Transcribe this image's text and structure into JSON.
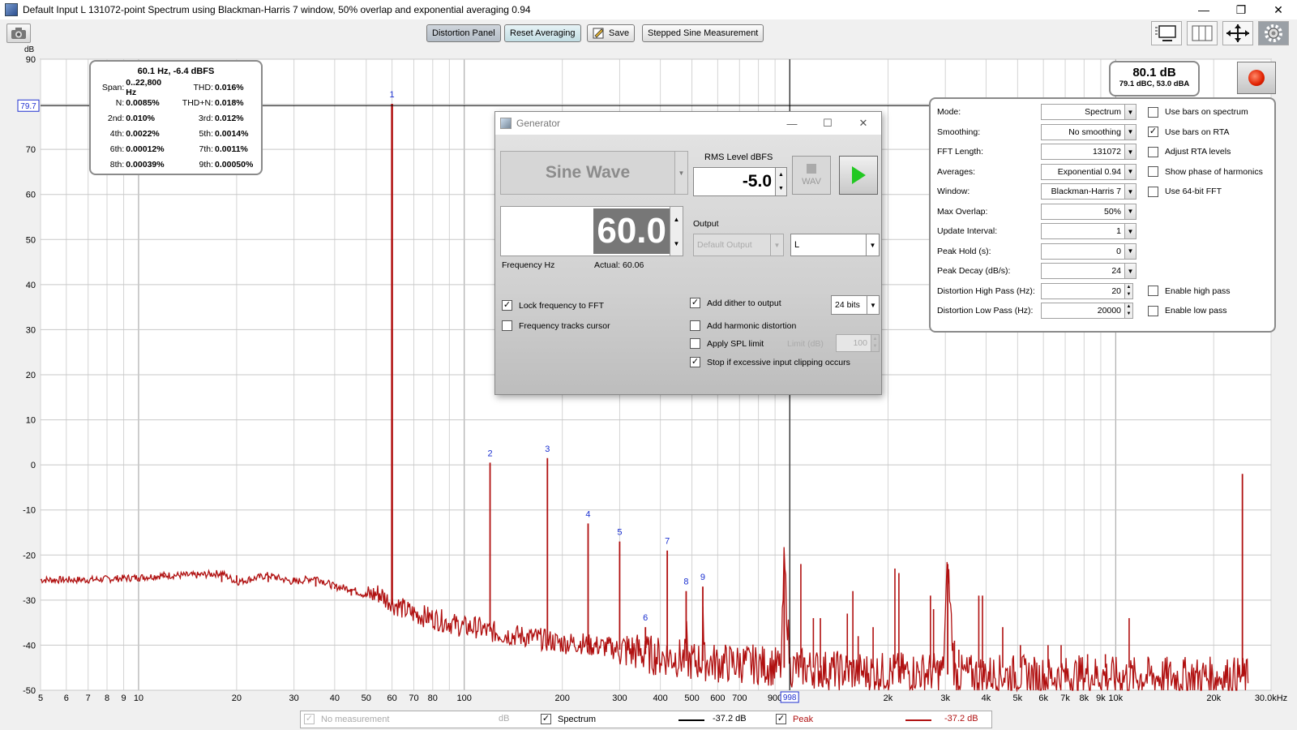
{
  "window": {
    "title": "Default Input L 131072-point Spectrum using Blackman-Harris 7 window, 50% overlap and exponential averaging 0.94",
    "minimize_glyph": "—",
    "restore_glyph": "❐",
    "close_glyph": "✕"
  },
  "toolbar": {
    "distortion_panel": "Distortion Panel",
    "reset_averaging": "Reset Averaging",
    "save": "Save",
    "stepped_sine": "Stepped Sine Measurement"
  },
  "graph": {
    "y_unit": "dB",
    "y_ticks": [
      "90",
      "80",
      "70",
      "60",
      "50",
      "40",
      "30",
      "20",
      "10",
      "0",
      "-10",
      "-20",
      "-30",
      "-40",
      "-50"
    ],
    "x_ticks": [
      {
        "v": 5,
        "l": "5"
      },
      {
        "v": 6,
        "l": "6"
      },
      {
        "v": 7,
        "l": "7"
      },
      {
        "v": 8,
        "l": "8"
      },
      {
        "v": 9,
        "l": "9"
      },
      {
        "v": 10,
        "l": "10"
      },
      {
        "v": 20,
        "l": "20"
      },
      {
        "v": 30,
        "l": "30"
      },
      {
        "v": 40,
        "l": "40"
      },
      {
        "v": 50,
        "l": "50"
      },
      {
        "v": 60,
        "l": "60"
      },
      {
        "v": 70,
        "l": "70"
      },
      {
        "v": 80,
        "l": "80"
      },
      {
        "v": 100,
        "l": "100"
      },
      {
        "v": 200,
        "l": "200"
      },
      {
        "v": 300,
        "l": "300"
      },
      {
        "v": 400,
        "l": "400"
      },
      {
        "v": 500,
        "l": "500"
      },
      {
        "v": 600,
        "l": "600"
      },
      {
        "v": 700,
        "l": "700"
      },
      {
        "v": 900,
        "l": "900"
      },
      {
        "v": 2000,
        "l": "2k"
      },
      {
        "v": 3000,
        "l": "3k"
      },
      {
        "v": 4000,
        "l": "4k"
      },
      {
        "v": 5000,
        "l": "5k"
      },
      {
        "v": 6000,
        "l": "6k"
      },
      {
        "v": 7000,
        "l": "7k"
      },
      {
        "v": 8000,
        "l": "8k"
      },
      {
        "v": 9000,
        "l": "9k"
      },
      {
        "v": 10000,
        "l": "10k"
      },
      {
        "v": 20000,
        "l": "20k"
      },
      {
        "v": 30000,
        "l": "30.0kHz"
      }
    ],
    "cursor_y_label": "79.7",
    "cursor_y": 79.7,
    "cursor_x_label": "998",
    "cursor_x": 998,
    "harmonic_markers": [
      {
        "label": "1",
        "freq": 60,
        "db": 80.1
      },
      {
        "label": "2",
        "freq": 120,
        "db": 0.5
      },
      {
        "label": "3",
        "freq": 180,
        "db": 1.5
      },
      {
        "label": "4",
        "freq": 240,
        "db": -13
      },
      {
        "label": "5",
        "freq": 300,
        "db": -17
      },
      {
        "label": "6",
        "freq": 360,
        "db": -36
      },
      {
        "label": "7",
        "freq": 420,
        "db": -19
      },
      {
        "label": "8",
        "freq": 480,
        "db": -28
      },
      {
        "label": "9",
        "freq": 540,
        "db": -27
      }
    ]
  },
  "chart_data": {
    "type": "line",
    "xlabel": "",
    "ylabel": "dB",
    "x_scale": "log",
    "xlim": [
      5,
      30000
    ],
    "ylim": [
      -50,
      90
    ],
    "series": [
      {
        "name": "Spectrum",
        "color": "#000000",
        "x": [],
        "values": []
      },
      {
        "name": "Peak",
        "color": "#b01010",
        "x": [
          5,
          7,
          10,
          12,
          15,
          18,
          20,
          25,
          30,
          35,
          40,
          45,
          50,
          55,
          58,
          60,
          62,
          65,
          70,
          80,
          90,
          100,
          110,
          118,
          120,
          122,
          130,
          150,
          170,
          178,
          180,
          182,
          200,
          230,
          238,
          240,
          242,
          280,
          298,
          300,
          302,
          340,
          358,
          360,
          362,
          400,
          418,
          420,
          422,
          470,
          478,
          480,
          482,
          530,
          538,
          540,
          542,
          600,
          700,
          850,
          940,
          960,
          1000,
          1100,
          1300,
          1700,
          2000,
          2500,
          2950,
          3050,
          3200,
          4000,
          5000,
          6000,
          7000,
          8000,
          10000,
          14000,
          18000,
          20000,
          23000,
          24000,
          24500,
          25000,
          26000
        ],
        "values": [
          -25.5,
          -25.5,
          -25,
          -24.5,
          -24.5,
          -24,
          -26,
          -24.5,
          -26,
          -25,
          -27,
          -27.5,
          -29,
          -28.5,
          -30,
          80.1,
          -31,
          -32,
          -33,
          -34,
          -35,
          -36,
          -36,
          -37,
          0.5,
          -37,
          -37.5,
          -38,
          -38.5,
          -39,
          1.5,
          -39,
          -39.5,
          -39.5,
          -40,
          -13,
          -40,
          -40.5,
          -41,
          -17,
          -41,
          -41.5,
          -42,
          -36,
          -42,
          -42.5,
          -42.5,
          -19,
          -42.5,
          -43,
          -43,
          -28,
          -43.5,
          -43.5,
          -43.5,
          -27,
          -43.5,
          -44,
          -44,
          -44.5,
          -45,
          -21,
          -45,
          -45,
          -45.5,
          -46,
          -46,
          -46,
          -46,
          -22,
          -46.5,
          -46.5,
          -46.5,
          -47,
          -47,
          -46.5,
          -47,
          -47,
          -47,
          -47,
          -47,
          -47,
          -2,
          -47,
          -48
        ]
      }
    ],
    "legend": "bottom"
  },
  "infobox": {
    "header": "60.1 Hz, -6.4 dBFS",
    "rows": [
      {
        "l1": "Span:",
        "v1": "0..22,800 Hz",
        "l2": "THD:",
        "v2": "0.016%"
      },
      {
        "l1": "N:",
        "v1": "0.0085%",
        "l2": "THD+N:",
        "v2": "0.018%"
      },
      {
        "l1": "2nd:",
        "v1": "0.010%",
        "l2": "3rd:",
        "v2": "0.012%"
      },
      {
        "l1": "4th:",
        "v1": "0.0022%",
        "l2": "5th:",
        "v2": "0.0014%"
      },
      {
        "l1": "6th:",
        "v1": "0.00012%",
        "l2": "7th:",
        "v2": "0.0011%"
      },
      {
        "l1": "8th:",
        "v1": "0.00039%",
        "l2": "9th:",
        "v2": "0.00050%"
      }
    ]
  },
  "spl": {
    "main": "80.1 dB",
    "sub": "79.1 dBC, 53.0 dBA"
  },
  "settings": {
    "rows": [
      {
        "label": "Mode:",
        "value": "Spectrum",
        "kind": "select"
      },
      {
        "label": "Smoothing:",
        "value": "No  smoothing",
        "kind": "select"
      },
      {
        "label": "FFT Length:",
        "value": "131072",
        "kind": "select"
      },
      {
        "label": "Averages:",
        "value": "Exponential 0.94",
        "kind": "select"
      },
      {
        "label": "Window:",
        "value": "Blackman-Harris 7",
        "kind": "select"
      },
      {
        "label": "Max Overlap:",
        "value": "50%",
        "kind": "select"
      },
      {
        "label": "Update Interval:",
        "value": "1",
        "kind": "select"
      },
      {
        "label": "Peak Hold (s):",
        "value": "0",
        "kind": "select"
      },
      {
        "label": "Peak Decay (dB/s):",
        "value": "24",
        "kind": "select"
      },
      {
        "label": "Distortion High Pass (Hz):",
        "value": "20",
        "kind": "spin"
      },
      {
        "label": "Distortion Low Pass (Hz):",
        "value": "20000",
        "kind": "spin"
      }
    ],
    "checks": [
      {
        "label": "Use bars on spectrum",
        "checked": false,
        "row": 0
      },
      {
        "label": "Use bars on RTA",
        "checked": true,
        "row": 1
      },
      {
        "label": "Adjust RTA levels",
        "checked": false,
        "row": 2
      },
      {
        "label": "Show phase of harmonics",
        "checked": false,
        "row": 3
      },
      {
        "label": "Use 64-bit FFT",
        "checked": false,
        "row": 4
      },
      {
        "label": "Enable high pass",
        "checked": false,
        "row": 9
      },
      {
        "label": "Enable low pass",
        "checked": false,
        "row": 10
      }
    ]
  },
  "generator": {
    "title": "Generator",
    "waveform": "Sine Wave",
    "rms_label": "RMS Level dBFS",
    "rms_value": "-5.0",
    "wav_label": "WAV",
    "frequency": "60.0",
    "frequency_label": "Frequency Hz",
    "actual": "Actual: 60.06",
    "output_label": "Output",
    "output_device": "Default Output",
    "channel": "L",
    "lock_freq": "Lock frequency to FFT",
    "freq_tracks": "Frequency tracks cursor",
    "add_dither": "Add dither to output",
    "bits": "24 bits",
    "add_harmonic": "Add harmonic distortion",
    "apply_spl": "Apply SPL limit",
    "limit_label": "Limit (dB)",
    "limit_value": "100",
    "stop_clip": "Stop if excessive input clipping occurs"
  },
  "legend": {
    "no_measurement": "No measurement",
    "no_measurement_unit": "dB",
    "spectrum": "Spectrum",
    "spectrum_value": "-37.2 dB",
    "peak": "Peak",
    "peak_value": "-37.2 dB"
  }
}
